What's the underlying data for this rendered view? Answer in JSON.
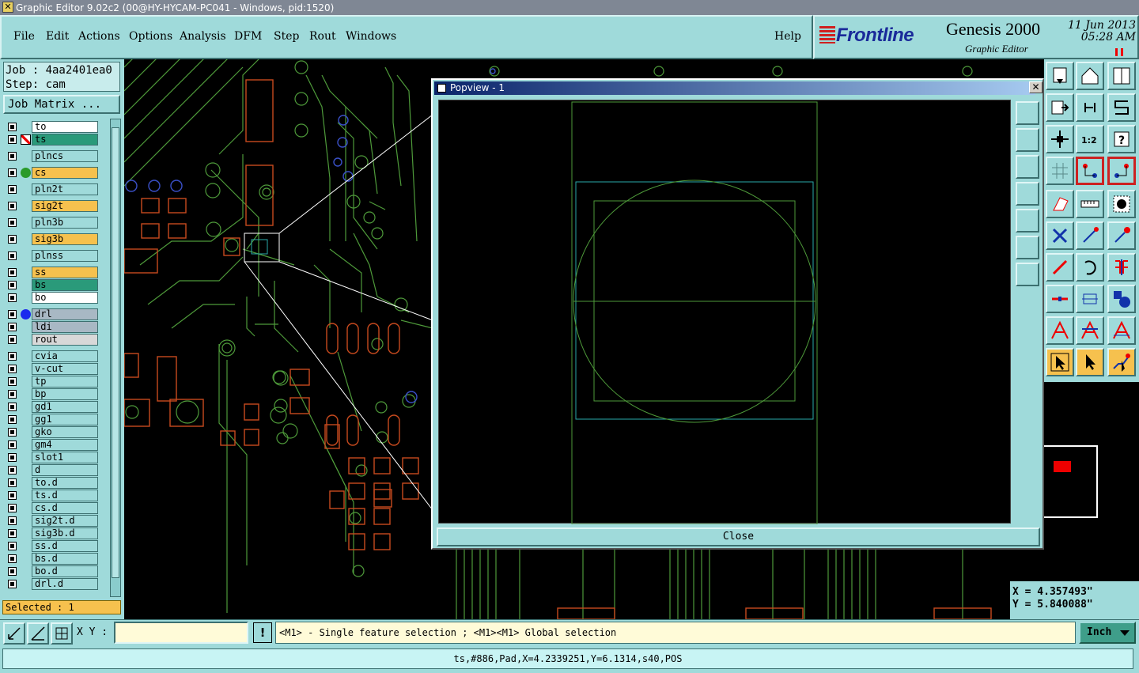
{
  "window": {
    "title": "Graphic Editor 9.02c2 (00@HY-HYCAM-PC041 - Windows, pid:1520)"
  },
  "menu": [
    "File",
    "Edit",
    "Actions",
    "Options",
    "Analysis",
    "DFM",
    "Step",
    "Rout",
    "Windows"
  ],
  "help_label": "Help",
  "brand": {
    "logo": "Frontline",
    "product": "Genesis 2000",
    "subtitle": "Graphic Editor",
    "date": "11 Jun 2013",
    "time": "05:28 AM"
  },
  "job": {
    "job_line": "Job : 4aa2401ea0",
    "step_line": "Step: cam",
    "matrix_button": "Job Matrix ..."
  },
  "layers": [
    {
      "name": "to",
      "color": "#ffffff",
      "dot": ""
    },
    {
      "name": "ts",
      "color": "#2a9a7a",
      "dot": "work"
    },
    {
      "name": "plncs",
      "color": "#9fdada",
      "dot": ""
    },
    {
      "name": "cs",
      "color": "#f6c14e",
      "dot": "#2a9a2a"
    },
    {
      "name": "pln2t",
      "color": "#9fdada",
      "dot": ""
    },
    {
      "name": "sig2t",
      "color": "#f6c14e",
      "dot": ""
    },
    {
      "name": "pln3b",
      "color": "#9fdada",
      "dot": ""
    },
    {
      "name": "sig3b",
      "color": "#f6c14e",
      "dot": ""
    },
    {
      "name": "plnss",
      "color": "#9fdada",
      "dot": ""
    },
    {
      "name": "ss",
      "color": "#f6c14e",
      "dot": ""
    },
    {
      "name": "bs",
      "color": "#2a9a7a",
      "dot": ""
    },
    {
      "name": "bo",
      "color": "#ffffff",
      "dot": ""
    },
    {
      "name": "drl",
      "color": "#a8b8c4",
      "dot": "#1a2aee"
    },
    {
      "name": "ldi",
      "color": "#a8b8c4",
      "dot": ""
    },
    {
      "name": "rout",
      "color": "#d8d8d8",
      "dot": ""
    },
    {
      "name": "cvia",
      "color": "#9fdada",
      "dot": ""
    },
    {
      "name": "v-cut",
      "color": "#9fdada",
      "dot": ""
    },
    {
      "name": "tp",
      "color": "#9fdada",
      "dot": ""
    },
    {
      "name": "bp",
      "color": "#9fdada",
      "dot": ""
    },
    {
      "name": "gd1",
      "color": "#9fdada",
      "dot": ""
    },
    {
      "name": "gg1",
      "color": "#9fdada",
      "dot": ""
    },
    {
      "name": "gko",
      "color": "#9fdada",
      "dot": ""
    },
    {
      "name": "gm4",
      "color": "#9fdada",
      "dot": ""
    },
    {
      "name": "slot1",
      "color": "#9fdada",
      "dot": ""
    },
    {
      "name": "d",
      "color": "#9fdada",
      "dot": ""
    },
    {
      "name": "to.d",
      "color": "#9fdada",
      "dot": ""
    },
    {
      "name": "ts.d",
      "color": "#9fdada",
      "dot": ""
    },
    {
      "name": "cs.d",
      "color": "#9fdada",
      "dot": ""
    },
    {
      "name": "sig2t.d",
      "color": "#9fdada",
      "dot": ""
    },
    {
      "name": "sig3b.d",
      "color": "#9fdada",
      "dot": ""
    },
    {
      "name": "ss.d",
      "color": "#9fdada",
      "dot": ""
    },
    {
      "name": "bs.d",
      "color": "#9fdada",
      "dot": ""
    },
    {
      "name": "bo.d",
      "color": "#9fdada",
      "dot": ""
    },
    {
      "name": "drl.d",
      "color": "#9fdada",
      "dot": ""
    }
  ],
  "selected": "Selected : 1",
  "popview": {
    "title": "Popview - 1",
    "close_button": "Close"
  },
  "coords": {
    "x": "X = 4.357493\"",
    "y": "Y = 5.840088\""
  },
  "bottom": {
    "xy_label": "X Y :",
    "xy_value": "",
    "message": "<M1> - Single feature selection ; <M1><M1> Global selection",
    "unit": "Inch"
  },
  "status": "ts,#886,Pad,X=4.2339251,Y=6.1314,s40,POS",
  "colors": {
    "panel": "#9fdada",
    "highlight": "#f6c14e",
    "features": "#c84a1e",
    "traces": "#4e9a3a"
  }
}
